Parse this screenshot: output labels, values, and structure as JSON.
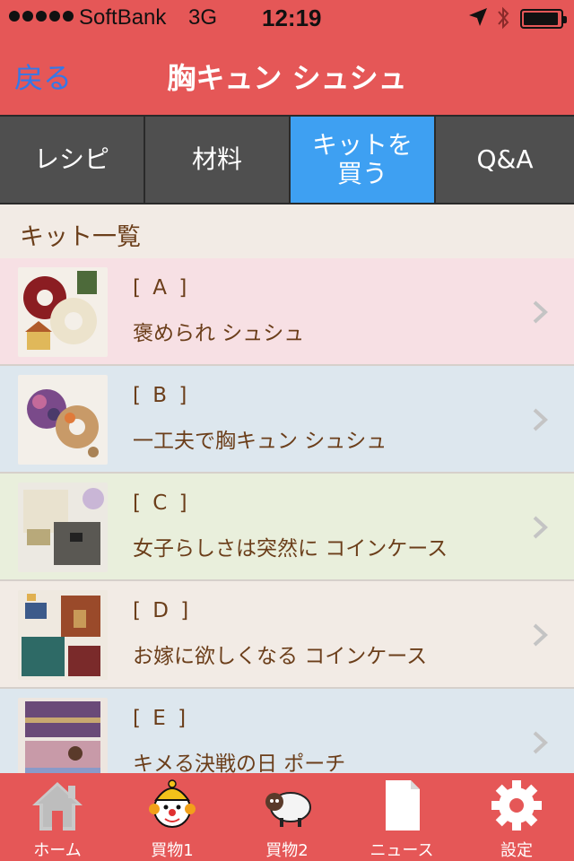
{
  "status_bar": {
    "carrier": "SoftBank",
    "network": "3G",
    "time": "12:19"
  },
  "nav": {
    "back_label": "戻る",
    "title": "胸キュン シュシュ"
  },
  "tabs": [
    {
      "label": "レシピ",
      "selected": false
    },
    {
      "label": "材料",
      "selected": false
    },
    {
      "label": "キットを\n買う",
      "selected": true
    },
    {
      "label": "Q&A",
      "selected": false
    }
  ],
  "section": {
    "title": "キット一覧"
  },
  "kits": [
    {
      "code": "[ A ]",
      "name": "褒められ シュシュ",
      "bg": "#f7e0e4"
    },
    {
      "code": "[ B ]",
      "name": "一工夫で胸キュン シュシュ",
      "bg": "#dde7ee"
    },
    {
      "code": "[ C ]",
      "name": "女子らしさは突然に コインケース",
      "bg": "#e9efdc"
    },
    {
      "code": "[ D ]",
      "name": "お嫁に欲しくなる コインケース",
      "bg": "#f2ebe5"
    },
    {
      "code": "[ E ]",
      "name": "キメる決戦の日 ポーチ",
      "bg": "#dde7ee"
    }
  ],
  "tabbar": [
    {
      "label": "ホーム",
      "icon": "home-icon"
    },
    {
      "label": "買物1",
      "icon": "clown-icon"
    },
    {
      "label": "買物2",
      "icon": "sheep-icon"
    },
    {
      "label": "ニュース",
      "icon": "document-icon"
    },
    {
      "label": "設定",
      "icon": "gear-icon"
    }
  ],
  "colors": {
    "accent_red": "#e55757",
    "tab_selected": "#3ea0f2",
    "tab_default": "#4f4f4f",
    "text_brown": "#6b3e1a",
    "back_blue": "#3478e8"
  }
}
